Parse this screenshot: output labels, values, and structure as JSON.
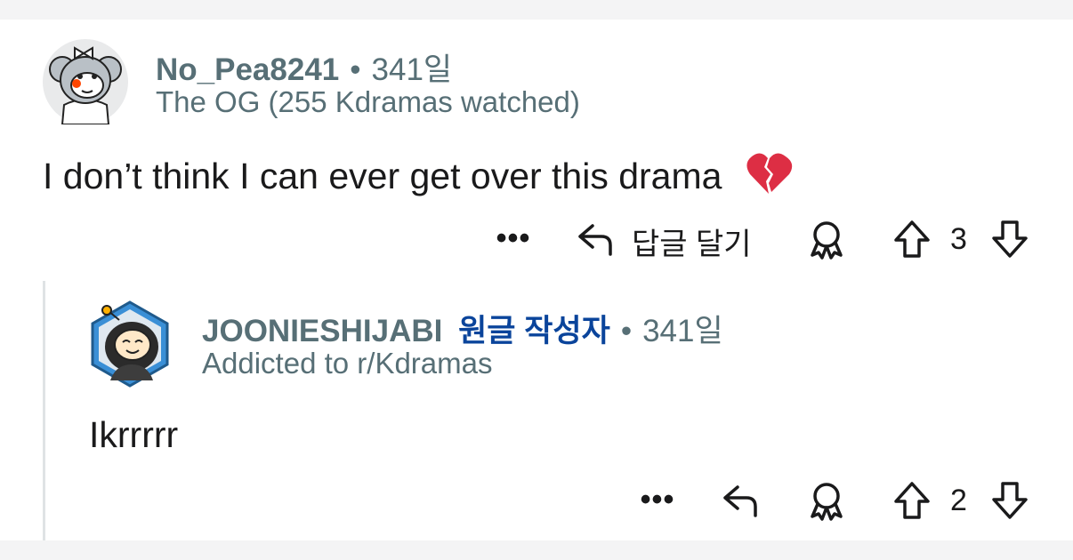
{
  "colors": {
    "meta_text": "#576f76",
    "op_tag": "#0a449b",
    "body_text": "#1a1a1b",
    "thread_line": "#dfe3e5",
    "band": "#f4f4f5"
  },
  "comments": [
    {
      "username": "No_Pea8241",
      "separator": "•",
      "time": "341일",
      "flair": "The OG (255 Kdramas watched)",
      "body": "I don’t think I can ever get over this drama",
      "emoji_icon": "broken-heart-icon",
      "actions": {
        "more": "•••",
        "reply_label": "답글 달기",
        "award_icon": "award-icon",
        "vote_count": "3"
      }
    },
    {
      "username": "JOONIESHIJABI",
      "op_tag": "원글 작성자",
      "separator": "•",
      "time": "341일",
      "flair": "Addicted to r/Kdramas",
      "body": "Ikrrrrr",
      "actions": {
        "more": "•••",
        "award_icon": "award-icon",
        "vote_count": "2"
      }
    }
  ]
}
